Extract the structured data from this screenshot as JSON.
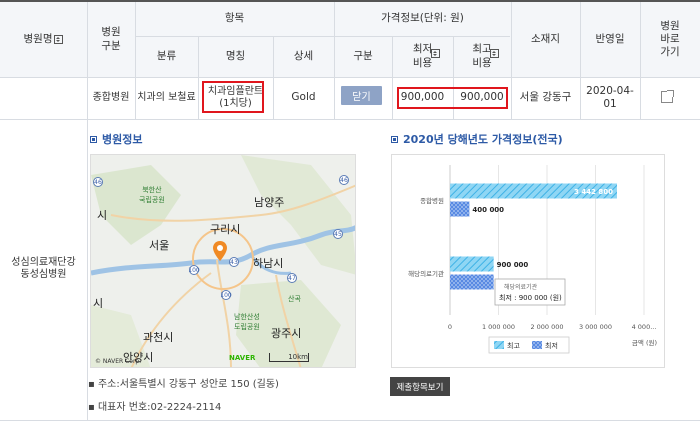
{
  "header": {
    "hospital_name": "병원명",
    "hospital_type": "병원\n구분",
    "item": "항목",
    "category": "분류",
    "name": "명칭",
    "detail": "상세",
    "price_info": "가격정보(단위: 원)",
    "division": "구분",
    "min_cost": "최저\n비용",
    "max_cost": "최고\n비용",
    "location": "소재지",
    "reflect_date": "반영일",
    "shortcut": "병원\n바로\n가기"
  },
  "row": {
    "hospital_type": "종합병원",
    "category": "치과의 보철료",
    "name": "치과임플란트\n(1치당)",
    "detail": "Gold",
    "division_button": "닫기",
    "min_cost": "900,000",
    "max_cost": "900,000",
    "location": "서울 강동구",
    "date": "2020-04-01",
    "hospital_name": "성심의료재단강\n동성심병원"
  },
  "hospital_info": {
    "title": "병원정보",
    "address": "주소:서울특별시 강동구 성안로 150 (길동)",
    "phone": "대표자 번호:02-2224-2114"
  },
  "map": {
    "labels": [
      "북한산\n국립공원",
      "구리시",
      "남양주",
      "서울",
      "하남시",
      "광주시",
      "과천시",
      "안양시",
      "산곡",
      "남한산성\n도립공원",
      "시",
      "시"
    ],
    "road_numbers": [
      "46",
      "46",
      "45",
      "43",
      "100",
      "100",
      "47"
    ],
    "brand": "NAVER",
    "scale": "10km",
    "copyright": "© NAVER Corp."
  },
  "price_chart": {
    "title": "2020년 당해년도 가격정보(전국)",
    "tooltip_line1": "해당의료기관",
    "tooltip_line2": "최저 : 900 000 (원)",
    "button": "제출항목보기"
  },
  "chart_data": {
    "type": "bar",
    "orientation": "horizontal",
    "categories": [
      "종합병원",
      "해당의료기관"
    ],
    "series": [
      {
        "name": "최고",
        "values": [
          3442800,
          900000
        ],
        "color": "#55c3ee"
      },
      {
        "name": "최저",
        "values": [
          400000,
          900000
        ],
        "color": "#4f86e3"
      }
    ],
    "data_labels": [
      [
        "3 442 800",
        "400 000"
      ],
      [
        "900 000",
        "900 000"
      ]
    ],
    "x_ticks": [
      "0",
      "1 000 000",
      "2 000 000",
      "3 000 000",
      "4 000..."
    ],
    "xlim": [
      0,
      4000000
    ],
    "xlabel": "금액 (원)",
    "legend_position": "bottom-center"
  }
}
